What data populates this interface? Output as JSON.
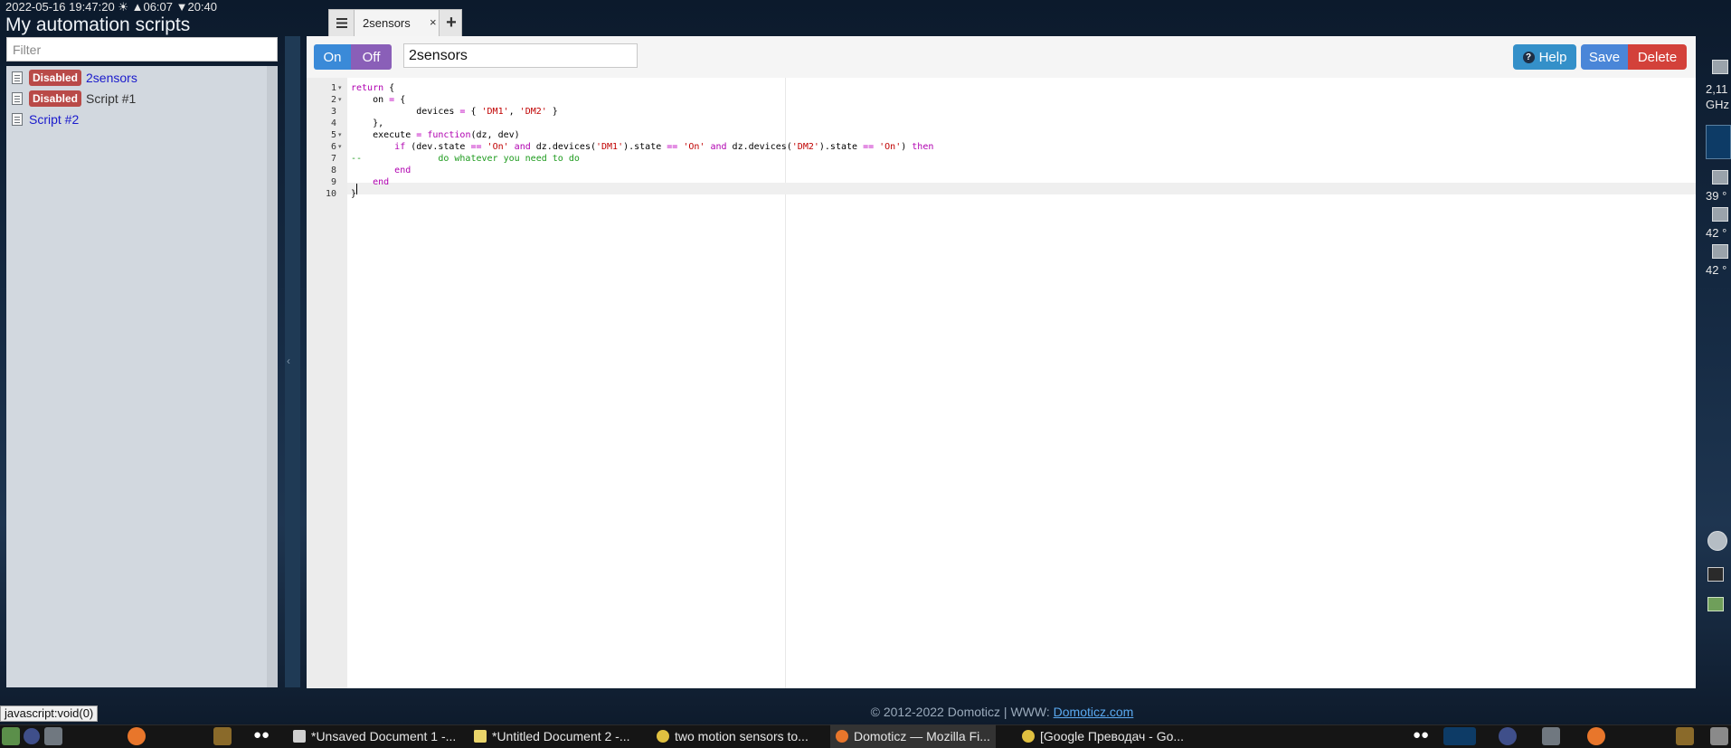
{
  "status_line": "2022-05-16 19:47:20 ☀ ▲06:07 ▼20:40",
  "page_title": "My automation scripts",
  "filter": {
    "placeholder": "Filter"
  },
  "scripts": [
    {
      "badge": "Disabled",
      "name": "2sensors"
    },
    {
      "badge": "Disabled",
      "name": "Script #1"
    },
    {
      "badge": "",
      "name": "Script #2"
    }
  ],
  "tab": {
    "label": "2sensors",
    "close": "×",
    "add": "+"
  },
  "toolbar": {
    "on_label": "On",
    "off_label": "Off",
    "script_name": "2sensors",
    "help_label": "Help",
    "help_icon": "?",
    "save_label": "Save",
    "delete_label": "Delete"
  },
  "code_lines": [
    "return {",
    "    on = {",
    "            devices = { 'DM1', 'DM2' }",
    "    },",
    "    execute = function(dz, dev)",
    "        if (dev.state == 'On' and dz.devices('DM1').state == 'On' and dz.devices('DM2').state == 'On') then",
    "--              do whatever you need to do",
    "        end",
    "    end",
    "}"
  ],
  "footer": {
    "text": "© 2012-2022 Domoticz | WWW: ",
    "link": "Domoticz.com"
  },
  "status_url": "javascript:void(0)",
  "taskbar": {
    "items": [
      {
        "label": "*Unsaved Document 1 -...",
        "icon": "text-editor-icon"
      },
      {
        "label": "*Untitled Document 2 -...",
        "icon": "text-editor-icon"
      },
      {
        "label": "two motion sensors to...",
        "icon": "chrome-icon"
      },
      {
        "label": "Domoticz — Mozilla Fi...",
        "icon": "firefox-icon"
      },
      {
        "label": "[Google Преводач - Go...",
        "icon": "chrome-icon"
      }
    ]
  },
  "desktop_widgets": {
    "cpu_freq": "2,11\nGHz",
    "temps": [
      "39 °",
      "42 °",
      "42 °"
    ]
  },
  "colors": {
    "badge_disabled": "#b94a48",
    "on_button": "#3a8ad8",
    "off_button": "#8a5fb8",
    "help_button": "#3490c9",
    "save_button": "#4a86d8",
    "delete_button": "#d3413a",
    "script_link": "#1a1acc"
  }
}
